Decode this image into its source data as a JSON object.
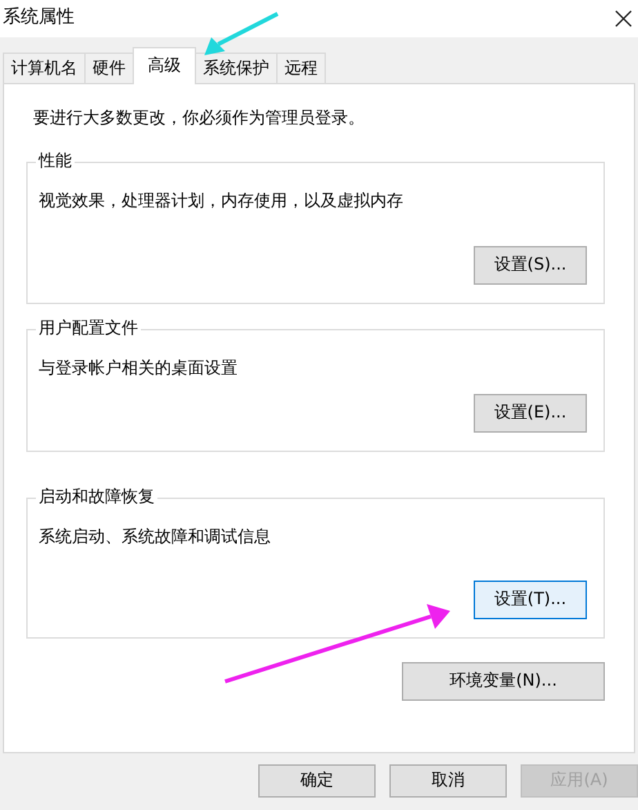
{
  "window": {
    "title": "系统属性"
  },
  "tabs": [
    {
      "label": "计算机名",
      "selected": false
    },
    {
      "label": "硬件",
      "selected": false
    },
    {
      "label": "高级",
      "selected": true
    },
    {
      "label": "系统保护",
      "selected": false
    },
    {
      "label": "远程",
      "selected": false
    }
  ],
  "notice": "要进行大多数更改，你必须作为管理员登录。",
  "groups": [
    {
      "title": "性能",
      "description": "视觉效果，处理器计划，内存使用，以及虚拟内存",
      "button": {
        "label": "设置(S)...",
        "focused": false
      }
    },
    {
      "title": "用户配置文件",
      "description": "与登录帐户相关的桌面设置",
      "button": {
        "label": "设置(E)...",
        "focused": false
      }
    },
    {
      "title": "启动和故障恢复",
      "description": "系统启动、系统故障和调试信息",
      "button": {
        "label": "设置(T)...",
        "focused": true
      }
    }
  ],
  "env_button": {
    "label": "环境变量(N)..."
  },
  "footer_buttons": [
    {
      "label": "确定",
      "disabled": false
    },
    {
      "label": "取消",
      "disabled": false
    },
    {
      "label": "应用(A)",
      "disabled": true
    }
  ],
  "annotation_arrows": [
    {
      "color": "#22d8dc"
    },
    {
      "color": "#ee22ee"
    }
  ]
}
